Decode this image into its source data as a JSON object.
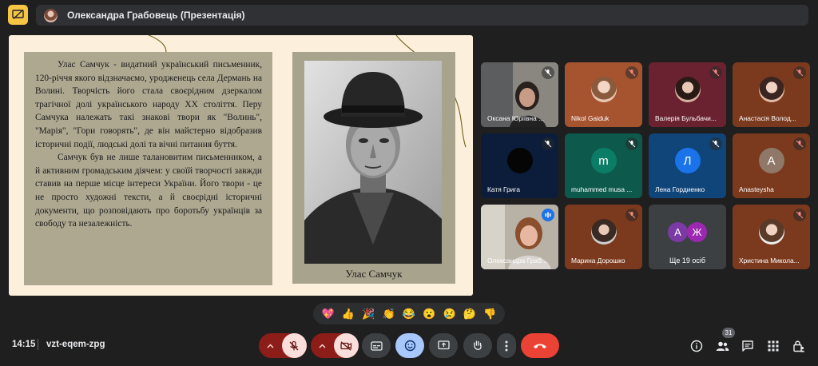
{
  "header": {
    "presenter_title": "Олександра Грабовець (Презентація)"
  },
  "slide": {
    "paragraph_1": "Улас Самчук - видатний український письменник, 120-річчя якого відзначаємо, уродженець села Дермань на Волині. Творчість його стала своєрідним дзеркалом трагічної долі українського народу XX століття. Перу Самчука належать такі знакові твори як \"Волинь\", \"Марія\", \"Гори говорять\", де він майстерно відобразив історичні події, людські долі та вічні питання буття.",
    "paragraph_2": "Самчук був не лише талановитим письменником, а й активним громадським діячем: у своїй творчості завжди ставив на перше місце інтереси України. Його твори - це не просто художні тексти, а й своєрідні історичні документи, що розповідають про боротьбу українців за свободу та незалежність.",
    "photo_caption": "Улас Самчук"
  },
  "participants": [
    {
      "name": "Оксана Юріївна ...",
      "type": "video",
      "mic_muted": true
    },
    {
      "name": "Nikol Gaiduk",
      "type": "avatar",
      "mic_muted": true
    },
    {
      "name": "Валерія Бульбачи...",
      "type": "avatar",
      "mic_muted": true
    },
    {
      "name": "Анастасія Волод...",
      "type": "avatar",
      "mic_muted": true
    },
    {
      "name": "Катя Грига",
      "type": "avatar",
      "mic_muted": true
    },
    {
      "name": "muhammed musa ...",
      "type": "letter",
      "letter": "m",
      "mic_muted": true
    },
    {
      "name": "Лена Гордиенко",
      "type": "letter",
      "letter": "Л",
      "mic_muted": true
    },
    {
      "name": "Anasteysha",
      "type": "letter",
      "letter": "А",
      "mic_muted": true
    },
    {
      "name": "Олександра Граб...",
      "type": "video",
      "mic_muted": false
    },
    {
      "name": "Марина Дорошко",
      "type": "avatar",
      "mic_muted": true
    },
    {
      "name": "Ще 19 осіб",
      "type": "more",
      "letters": [
        "А",
        "Ж"
      ]
    },
    {
      "name": "Христина Микола...",
      "type": "avatar",
      "mic_muted": true
    }
  ],
  "reactions": [
    "💖",
    "👍",
    "🎉",
    "👏",
    "😂",
    "😮",
    "😢",
    "🤔",
    "👎"
  ],
  "footer": {
    "time": "14:15",
    "meeting_code": "vzt-eqem-zpg",
    "participant_count": "31"
  },
  "colors": {
    "background": "#1f1f1f",
    "slide_bg": "#fcf0dc",
    "slide_panel": "#aea891",
    "end_call": "#ea4335",
    "muted_control": "#8c1d18",
    "present_icon": "#f6c544",
    "reactions_active": "#a8c7fa"
  }
}
